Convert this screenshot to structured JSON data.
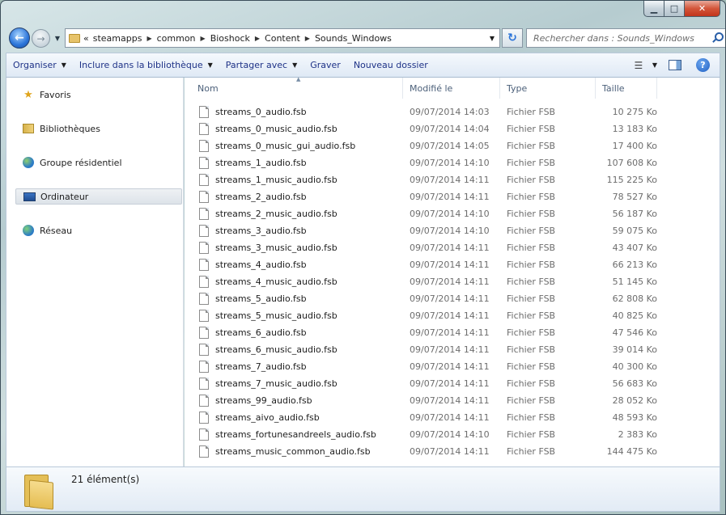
{
  "window": {
    "caption": {
      "minimize": "▁",
      "maximize": "□",
      "close": "✕"
    }
  },
  "nav": {
    "back_icon": "back-arrow-icon",
    "forward_icon": "forward-arrow-icon",
    "back_glyph": "←",
    "forward_glyph": "→",
    "history_glyph": "▼"
  },
  "address": {
    "overflow": "«",
    "crumbs": [
      "steamapps",
      "common",
      "Bioshock",
      "Content",
      "Sounds_Windows"
    ],
    "dropdown_glyph": "▼",
    "refresh_glyph": "↻"
  },
  "search": {
    "placeholder": "Rechercher dans : Sounds_Windows"
  },
  "toolbar": {
    "organize": "Organiser",
    "include": "Inclure dans la bibliothèque",
    "share": "Partager avec",
    "burn": "Graver",
    "new_folder": "Nouveau dossier",
    "dropdown_glyph": "▼",
    "view_glyph": "☰",
    "help_glyph": "?"
  },
  "sidebar": {
    "items": [
      {
        "label": "Favoris",
        "icon": "star-icon"
      },
      {
        "label": "Bibliothèques",
        "icon": "library-icon"
      },
      {
        "label": "Groupe résidentiel",
        "icon": "homegroup-icon"
      },
      {
        "label": "Ordinateur",
        "icon": "computer-icon",
        "selected": true
      },
      {
        "label": "Réseau",
        "icon": "network-icon"
      }
    ],
    "star_glyph": "★"
  },
  "columns": {
    "name": "Nom",
    "modified": "Modifié le",
    "type": "Type",
    "size": "Taille",
    "sort_glyph": "▲"
  },
  "files": [
    {
      "name": "streams_0_audio.fsb",
      "modified": "09/07/2014 14:03",
      "type": "Fichier FSB",
      "size": "10 275 Ko"
    },
    {
      "name": "streams_0_music_audio.fsb",
      "modified": "09/07/2014 14:04",
      "type": "Fichier FSB",
      "size": "13 183 Ko"
    },
    {
      "name": "streams_0_music_gui_audio.fsb",
      "modified": "09/07/2014 14:05",
      "type": "Fichier FSB",
      "size": "17 400 Ko"
    },
    {
      "name": "streams_1_audio.fsb",
      "modified": "09/07/2014 14:10",
      "type": "Fichier FSB",
      "size": "107 608 Ko"
    },
    {
      "name": "streams_1_music_audio.fsb",
      "modified": "09/07/2014 14:11",
      "type": "Fichier FSB",
      "size": "115 225 Ko"
    },
    {
      "name": "streams_2_audio.fsb",
      "modified": "09/07/2014 14:11",
      "type": "Fichier FSB",
      "size": "78 527 Ko"
    },
    {
      "name": "streams_2_music_audio.fsb",
      "modified": "09/07/2014 14:10",
      "type": "Fichier FSB",
      "size": "56 187 Ko"
    },
    {
      "name": "streams_3_audio.fsb",
      "modified": "09/07/2014 14:10",
      "type": "Fichier FSB",
      "size": "59 075 Ko"
    },
    {
      "name": "streams_3_music_audio.fsb",
      "modified": "09/07/2014 14:11",
      "type": "Fichier FSB",
      "size": "43 407 Ko"
    },
    {
      "name": "streams_4_audio.fsb",
      "modified": "09/07/2014 14:11",
      "type": "Fichier FSB",
      "size": "66 213 Ko"
    },
    {
      "name": "streams_4_music_audio.fsb",
      "modified": "09/07/2014 14:11",
      "type": "Fichier FSB",
      "size": "51 145 Ko"
    },
    {
      "name": "streams_5_audio.fsb",
      "modified": "09/07/2014 14:11",
      "type": "Fichier FSB",
      "size": "62 808 Ko"
    },
    {
      "name": "streams_5_music_audio.fsb",
      "modified": "09/07/2014 14:11",
      "type": "Fichier FSB",
      "size": "40 825 Ko"
    },
    {
      "name": "streams_6_audio.fsb",
      "modified": "09/07/2014 14:11",
      "type": "Fichier FSB",
      "size": "47 546 Ko"
    },
    {
      "name": "streams_6_music_audio.fsb",
      "modified": "09/07/2014 14:11",
      "type": "Fichier FSB",
      "size": "39 014 Ko"
    },
    {
      "name": "streams_7_audio.fsb",
      "modified": "09/07/2014 14:11",
      "type": "Fichier FSB",
      "size": "40 300 Ko"
    },
    {
      "name": "streams_7_music_audio.fsb",
      "modified": "09/07/2014 14:11",
      "type": "Fichier FSB",
      "size": "56 683 Ko"
    },
    {
      "name": "streams_99_audio.fsb",
      "modified": "09/07/2014 14:11",
      "type": "Fichier FSB",
      "size": "28 052 Ko"
    },
    {
      "name": "streams_aivo_audio.fsb",
      "modified": "09/07/2014 14:11",
      "type": "Fichier FSB",
      "size": "48 593 Ko"
    },
    {
      "name": "streams_fortunesandreels_audio.fsb",
      "modified": "09/07/2014 14:10",
      "type": "Fichier FSB",
      "size": "2 383 Ko"
    },
    {
      "name": "streams_music_common_audio.fsb",
      "modified": "09/07/2014 14:11",
      "type": "Fichier FSB",
      "size": "144 475 Ko"
    }
  ],
  "details": {
    "count": "21 élément(s)",
    "icon": "folder-icon"
  },
  "colors": {
    "accent": "#1e3287",
    "selection": "#dde3e9",
    "toolbar": "#dfe9f5"
  }
}
